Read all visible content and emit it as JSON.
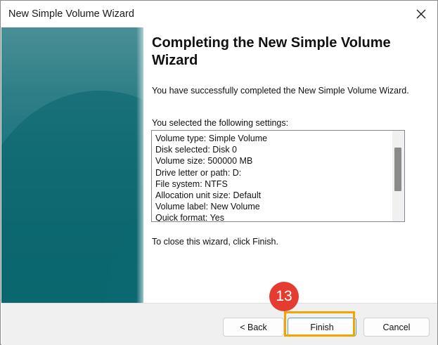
{
  "window": {
    "title": "New Simple Volume Wizard"
  },
  "content": {
    "heading": "Completing the New Simple Volume Wizard",
    "success_text": "You have successfully completed the New Simple Volume Wizard.",
    "selected_label": "You selected the following settings:",
    "settings": [
      "Volume type: Simple Volume",
      "Disk selected: Disk 0",
      "Volume size: 500000 MB",
      "Drive letter or path: D:",
      "File system: NTFS",
      "Allocation unit size: Default",
      "Volume label: New Volume",
      "Quick format: Yes"
    ],
    "close_text": "To close this wizard, click Finish."
  },
  "buttons": {
    "back": "< Back",
    "finish": "Finish",
    "cancel": "Cancel"
  },
  "annotation": {
    "step_number": "13"
  },
  "colors": {
    "highlight": "#f0a500",
    "badge": "#e43c30",
    "side_panel": "#106c74"
  },
  "icons": {
    "close": "close-icon"
  }
}
